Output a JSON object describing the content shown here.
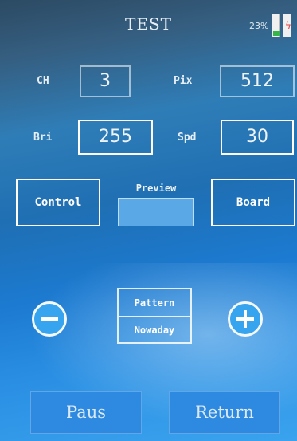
{
  "header": {
    "title": "TEST",
    "battery_percent": "23%",
    "battery_level": 0.23
  },
  "settings": {
    "ch": {
      "label": "CH",
      "value": "3"
    },
    "pix": {
      "label": "Pix",
      "value": "512"
    },
    "bri": {
      "label": "Bri",
      "value": "255"
    },
    "spd": {
      "label": "Spd",
      "value": "30"
    }
  },
  "controls": {
    "control_label": "Control",
    "preview_label": "Preview",
    "board_label": "Board"
  },
  "pattern": {
    "title": "Pattern",
    "value": "Nowaday"
  },
  "footer": {
    "pause_label": "Paus",
    "return_label": "Return"
  },
  "colors": {
    "accent": "#2d8ae0",
    "preview": "#5aa9e6",
    "battery_fill": "#38b54a"
  }
}
